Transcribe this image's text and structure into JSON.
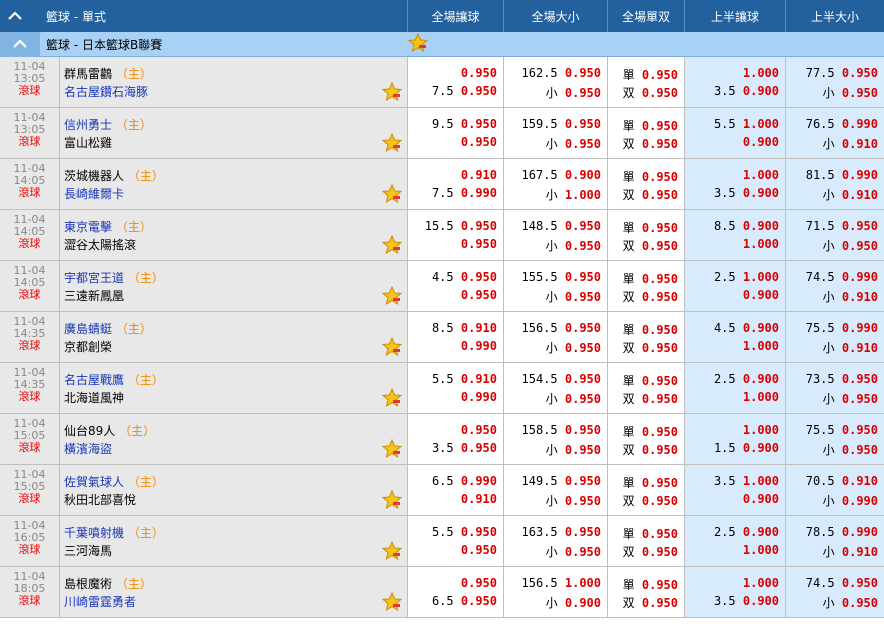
{
  "header": {
    "title": "籃球 - 單式",
    "cols": [
      "全場讓球",
      "全場大小",
      "全場單双",
      "上半讓球",
      "上半大小"
    ]
  },
  "league": {
    "name": "籃球 - 日本籃球B聯賽"
  },
  "home_mark": "（主）",
  "matches": [
    {
      "date": "11-04",
      "time": "13:05",
      "live": "滾球",
      "t1": "群馬雷鸛",
      "t2": "名古屋鑽石海豚",
      "h1": "",
      "o1": "0.950",
      "h2": "7.5",
      "o2": "0.950",
      "tl1": "162.5",
      "to1": "0.950",
      "tl2": "小",
      "to2": "0.950",
      "s1": "單",
      "so1": "0.950",
      "s2": "双",
      "so2": "0.950",
      "fh1": "",
      "fo1": "1.000",
      "fh2": "3.5",
      "fo2": "0.900",
      "ft1": "77.5",
      "fto1": "0.950",
      "ft2": "小",
      "fto2": "0.950"
    },
    {
      "date": "11-04",
      "time": "13:05",
      "live": "滾球",
      "t1": "信州勇士",
      "t2": "富山松雞",
      "h1": "9.5",
      "o1": "0.950",
      "h2": "",
      "o2": "0.950",
      "tl1": "159.5",
      "to1": "0.950",
      "tl2": "小",
      "to2": "0.950",
      "s1": "單",
      "so1": "0.950",
      "s2": "双",
      "so2": "0.950",
      "fh1": "5.5",
      "fo1": "1.000",
      "fh2": "",
      "fo2": "0.900",
      "ft1": "76.5",
      "fto1": "0.990",
      "ft2": "小",
      "fto2": "0.910"
    },
    {
      "date": "11-04",
      "time": "14:05",
      "live": "滾球",
      "t1": "茨城機器人",
      "t2": "長崎維爾卡",
      "h1": "",
      "o1": "0.910",
      "h2": "7.5",
      "o2": "0.990",
      "tl1": "167.5",
      "to1": "0.900",
      "tl2": "小",
      "to2": "1.000",
      "s1": "單",
      "so1": "0.950",
      "s2": "双",
      "so2": "0.950",
      "fh1": "",
      "fo1": "1.000",
      "fh2": "3.5",
      "fo2": "0.900",
      "ft1": "81.5",
      "fto1": "0.990",
      "ft2": "小",
      "fto2": "0.910"
    },
    {
      "date": "11-04",
      "time": "14:05",
      "live": "滾球",
      "t1": "東京電擊",
      "t2": "澀谷太陽搖滾",
      "h1": "15.5",
      "o1": "0.950",
      "h2": "",
      "o2": "0.950",
      "tl1": "148.5",
      "to1": "0.950",
      "tl2": "小",
      "to2": "0.950",
      "s1": "單",
      "so1": "0.950",
      "s2": "双",
      "so2": "0.950",
      "fh1": "8.5",
      "fo1": "0.900",
      "fh2": "",
      "fo2": "1.000",
      "ft1": "71.5",
      "fto1": "0.950",
      "ft2": "小",
      "fto2": "0.950"
    },
    {
      "date": "11-04",
      "time": "14:05",
      "live": "滾球",
      "t1": "宇都宮王道",
      "t2": "三遠新鳳凰",
      "h1": "4.5",
      "o1": "0.950",
      "h2": "",
      "o2": "0.950",
      "tl1": "155.5",
      "to1": "0.950",
      "tl2": "小",
      "to2": "0.950",
      "s1": "單",
      "so1": "0.950",
      "s2": "双",
      "so2": "0.950",
      "fh1": "2.5",
      "fo1": "1.000",
      "fh2": "",
      "fo2": "0.900",
      "ft1": "74.5",
      "fto1": "0.990",
      "ft2": "小",
      "fto2": "0.910"
    },
    {
      "date": "11-04",
      "time": "14:35",
      "live": "滾球",
      "t1": "廣島蜻蜓",
      "t2": "京都創榮",
      "h1": "8.5",
      "o1": "0.910",
      "h2": "",
      "o2": "0.990",
      "tl1": "156.5",
      "to1": "0.950",
      "tl2": "小",
      "to2": "0.950",
      "s1": "單",
      "so1": "0.950",
      "s2": "双",
      "so2": "0.950",
      "fh1": "4.5",
      "fo1": "0.900",
      "fh2": "",
      "fo2": "1.000",
      "ft1": "75.5",
      "fto1": "0.990",
      "ft2": "小",
      "fto2": "0.910"
    },
    {
      "date": "11-04",
      "time": "14:35",
      "live": "滾球",
      "t1": "名古屋戰鷹",
      "t2": "北海道風神",
      "h1": "5.5",
      "o1": "0.910",
      "h2": "",
      "o2": "0.990",
      "tl1": "154.5",
      "to1": "0.950",
      "tl2": "小",
      "to2": "0.950",
      "s1": "單",
      "so1": "0.950",
      "s2": "双",
      "so2": "0.950",
      "fh1": "2.5",
      "fo1": "0.900",
      "fh2": "",
      "fo2": "1.000",
      "ft1": "73.5",
      "fto1": "0.950",
      "ft2": "小",
      "fto2": "0.950"
    },
    {
      "date": "11-04",
      "time": "15:05",
      "live": "滾球",
      "t1": "仙台89人",
      "t2": "橫濱海盜",
      "h1": "",
      "o1": "0.950",
      "h2": "3.5",
      "o2": "0.950",
      "tl1": "158.5",
      "to1": "0.950",
      "tl2": "小",
      "to2": "0.950",
      "s1": "單",
      "so1": "0.950",
      "s2": "双",
      "so2": "0.950",
      "fh1": "",
      "fo1": "1.000",
      "fh2": "1.5",
      "fo2": "0.900",
      "ft1": "75.5",
      "fto1": "0.950",
      "ft2": "小",
      "fto2": "0.950"
    },
    {
      "date": "11-04",
      "time": "15:05",
      "live": "滾球",
      "t1": "佐賀氣球人",
      "t2": "秋田北部喜悅",
      "h1": "6.5",
      "o1": "0.990",
      "h2": "",
      "o2": "0.910",
      "tl1": "149.5",
      "to1": "0.950",
      "tl2": "小",
      "to2": "0.950",
      "s1": "單",
      "so1": "0.950",
      "s2": "双",
      "so2": "0.950",
      "fh1": "3.5",
      "fo1": "1.000",
      "fh2": "",
      "fo2": "0.900",
      "ft1": "70.5",
      "fto1": "0.910",
      "ft2": "小",
      "fto2": "0.990"
    },
    {
      "date": "11-04",
      "time": "16:05",
      "live": "滾球",
      "t1": "千葉噴射機",
      "t2": "三河海馬",
      "h1": "5.5",
      "o1": "0.950",
      "h2": "",
      "o2": "0.950",
      "tl1": "163.5",
      "to1": "0.950",
      "tl2": "小",
      "to2": "0.950",
      "s1": "單",
      "so1": "0.950",
      "s2": "双",
      "so2": "0.950",
      "fh1": "2.5",
      "fo1": "0.900",
      "fh2": "",
      "fo2": "1.000",
      "ft1": "78.5",
      "fto1": "0.990",
      "ft2": "小",
      "fto2": "0.910"
    },
    {
      "date": "11-04",
      "time": "18:05",
      "live": "滾球",
      "t1": "島根魔術",
      "t2": "川崎雷霆勇者",
      "h1": "",
      "o1": "0.950",
      "h2": "6.5",
      "o2": "0.950",
      "tl1": "156.5",
      "to1": "1.000",
      "tl2": "小",
      "to2": "0.900",
      "s1": "單",
      "so1": "0.950",
      "s2": "双",
      "so2": "0.950",
      "fh1": "",
      "fo1": "1.000",
      "fh2": "3.5",
      "fo2": "0.900",
      "ft1": "74.5",
      "fto1": "0.950",
      "ft2": "小",
      "fto2": "0.950"
    }
  ]
}
